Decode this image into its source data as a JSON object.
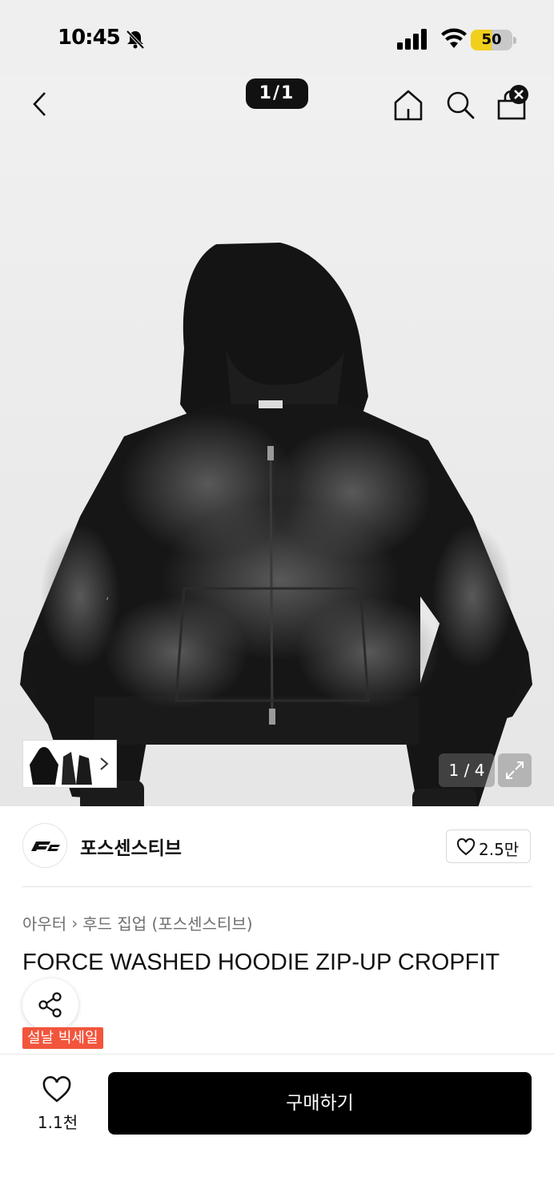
{
  "status_bar": {
    "time": "10:45",
    "battery_level": "50",
    "battery_fraction": 0.5
  },
  "top_nav": {
    "counter": "1/1"
  },
  "gallery": {
    "counter": "1 / 4"
  },
  "brand": {
    "name": "포스센스티브",
    "likes": "2.5만"
  },
  "breadcrumb": {
    "items": [
      "아우터",
      "후드 집업 (포스센스티브)"
    ],
    "separator": "›"
  },
  "product": {
    "title": "FORCE WASHED HOODIE ZIP-UP CROPFIT",
    "sale_badge": "설날 빅세일"
  },
  "bottom_bar": {
    "wish_count": "1.1천",
    "buy_label": "구매하기"
  },
  "colors": {
    "accent_badge": "#f2553c",
    "buy_button": "#000000",
    "battery_fill": "#f2cf1b"
  }
}
